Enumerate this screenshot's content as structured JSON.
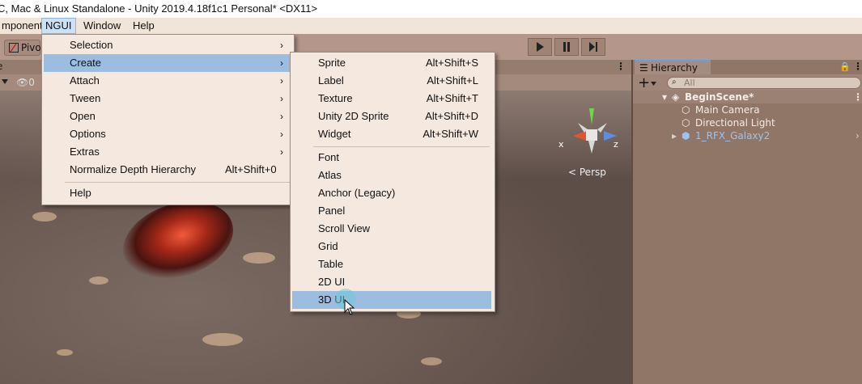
{
  "window": {
    "title": "C, Mac & Linux Standalone - Unity 2019.4.18f1c1 Personal* <DX11>"
  },
  "menubar": {
    "items": [
      "mponent",
      "NGUI",
      "Window",
      "Help"
    ]
  },
  "toolbar": {
    "pivot_label": "Pivo"
  },
  "scene": {
    "tab_label": "e",
    "hidden_count": "0",
    "persp_label": "Persp",
    "axis_x": "x",
    "axis_z": "z"
  },
  "ngui_menu": {
    "items": [
      "Selection",
      "Create",
      "Attach",
      "Tween",
      "Open",
      "Options",
      "Extras",
      "Normalize Depth Hierarchy",
      "Help"
    ],
    "normalize_shortcut": "Alt+Shift+0"
  },
  "create_menu": {
    "items": [
      {
        "label": "Sprite",
        "shortcut": "Alt+Shift+S"
      },
      {
        "label": "Label",
        "shortcut": "Alt+Shift+L"
      },
      {
        "label": "Texture",
        "shortcut": "Alt+Shift+T"
      },
      {
        "label": "Unity 2D Sprite",
        "shortcut": "Alt+Shift+D"
      },
      {
        "label": "Widget",
        "shortcut": "Alt+Shift+W"
      },
      {
        "label": "Font",
        "shortcut": ""
      },
      {
        "label": "Atlas",
        "shortcut": ""
      },
      {
        "label": "Anchor (Legacy)",
        "shortcut": ""
      },
      {
        "label": "Panel",
        "shortcut": ""
      },
      {
        "label": "Scroll View",
        "shortcut": ""
      },
      {
        "label": "Grid",
        "shortcut": ""
      },
      {
        "label": "Table",
        "shortcut": ""
      },
      {
        "label": "2D UI",
        "shortcut": ""
      },
      {
        "label": "3D UI",
        "shortcut": ""
      }
    ]
  },
  "hierarchy": {
    "tab_label": "Hierarchy",
    "search_placeholder": "All",
    "scene_name": "BeginScene*",
    "objects": [
      "Main Camera",
      "Directional Light",
      "1_RFX_Galaxy2"
    ]
  },
  "colors": {
    "menu_highlight": "#9dbde0",
    "menu_bg": "#f5e8df",
    "hierarchy_bg": "#8f7667",
    "prefab_blue": "#9cc3ef"
  }
}
